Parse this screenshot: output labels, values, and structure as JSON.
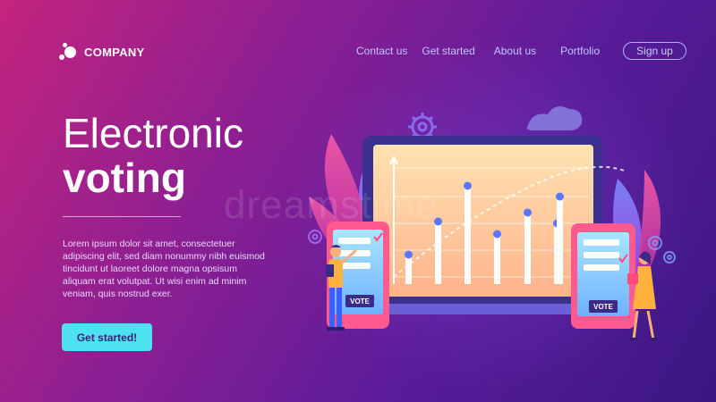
{
  "logo": {
    "text": "COMPANY"
  },
  "nav": {
    "items": [
      "Contact us",
      "Get started",
      "About us",
      "Portfolio"
    ],
    "signup_label": "Sign up"
  },
  "hero": {
    "title_line1": "Electronic",
    "title_line2": "voting",
    "description": "Lorem ipsum dolor sit amet, consectetuer adipiscing elit, sed diam nonummy nibh euismod tincidunt ut laoreet dolore magna opsisum aliquam erat volutpat. Ut wisi enim ad minim veniam, quis nostrud exer.",
    "cta_label": "Get started!"
  },
  "illustration": {
    "left_phone_label": "VOTE",
    "right_phone_label": "VOTE",
    "watermark": "dreamstime"
  },
  "colors": {
    "accent": "#4ee2f0",
    "nav_text": "#bfc6ff",
    "bg_start": "#c4247e",
    "bg_end": "#3a1782"
  }
}
